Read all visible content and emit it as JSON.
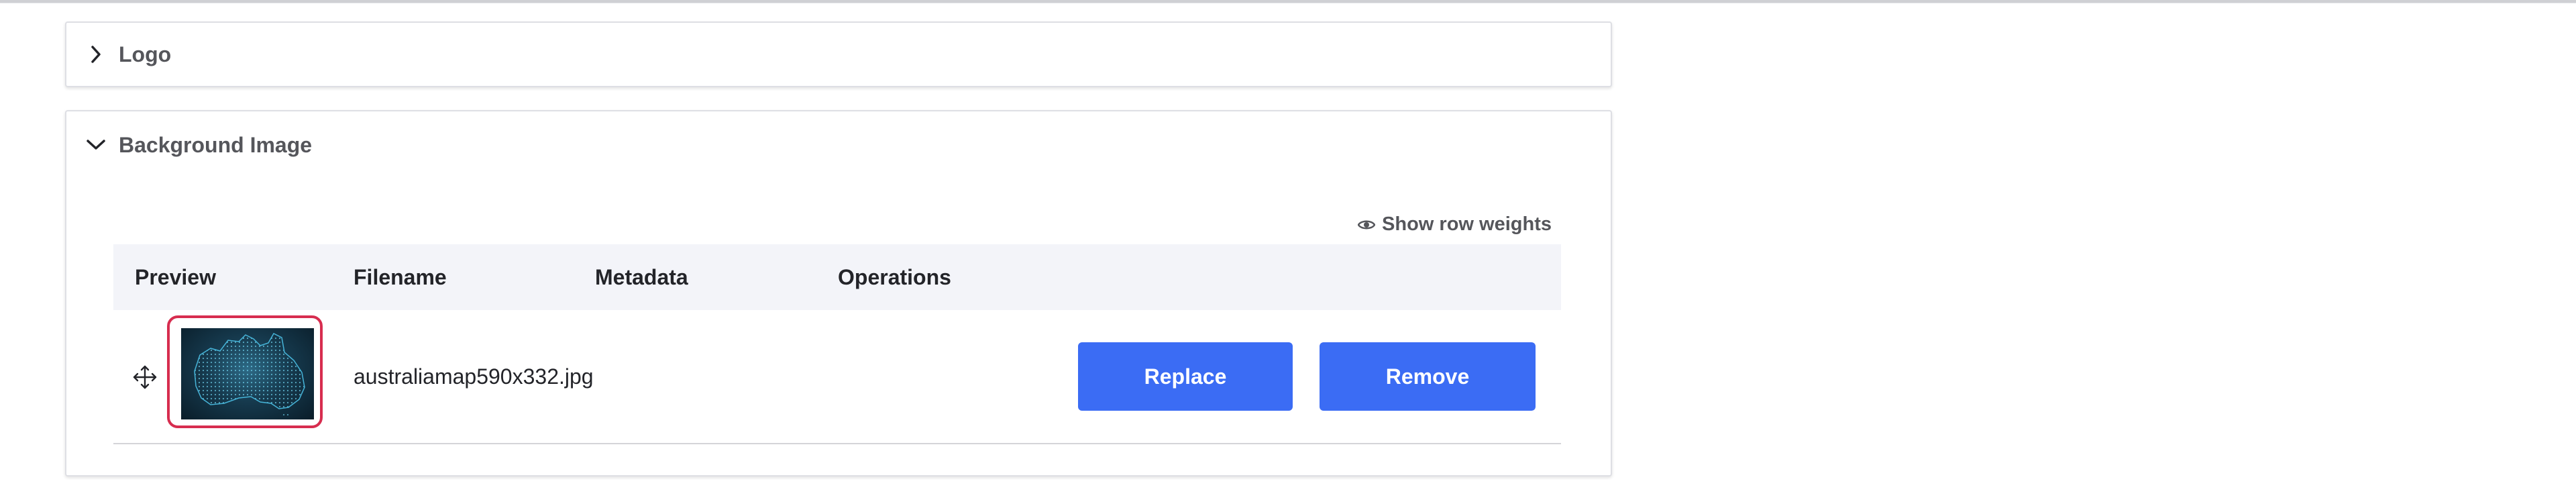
{
  "sections": {
    "logo": {
      "title": "Logo",
      "expanded": false
    },
    "background_image": {
      "title": "Background Image",
      "expanded": true,
      "show_row_weights_label": "Show row weights",
      "table": {
        "headers": [
          "Preview",
          "Filename",
          "Metadata",
          "Operations"
        ],
        "rows": [
          {
            "filename": "australiamap590x332.jpg",
            "metadata": "",
            "preview_alt": "Map of Australia",
            "actions": {
              "replace_label": "Replace",
              "remove_label": "Remove"
            }
          }
        ]
      }
    }
  },
  "icons": {
    "collapsed_chevron": "chevron-right-icon",
    "expanded_chevron": "chevron-down-icon",
    "row_weights": "eye-icon",
    "drag": "move-icon"
  },
  "colors": {
    "primary_button": "#3b6cf4",
    "selection_outline": "#d72d4f",
    "table_header_bg": "#f3f4f9",
    "title_text": "#55565b"
  }
}
